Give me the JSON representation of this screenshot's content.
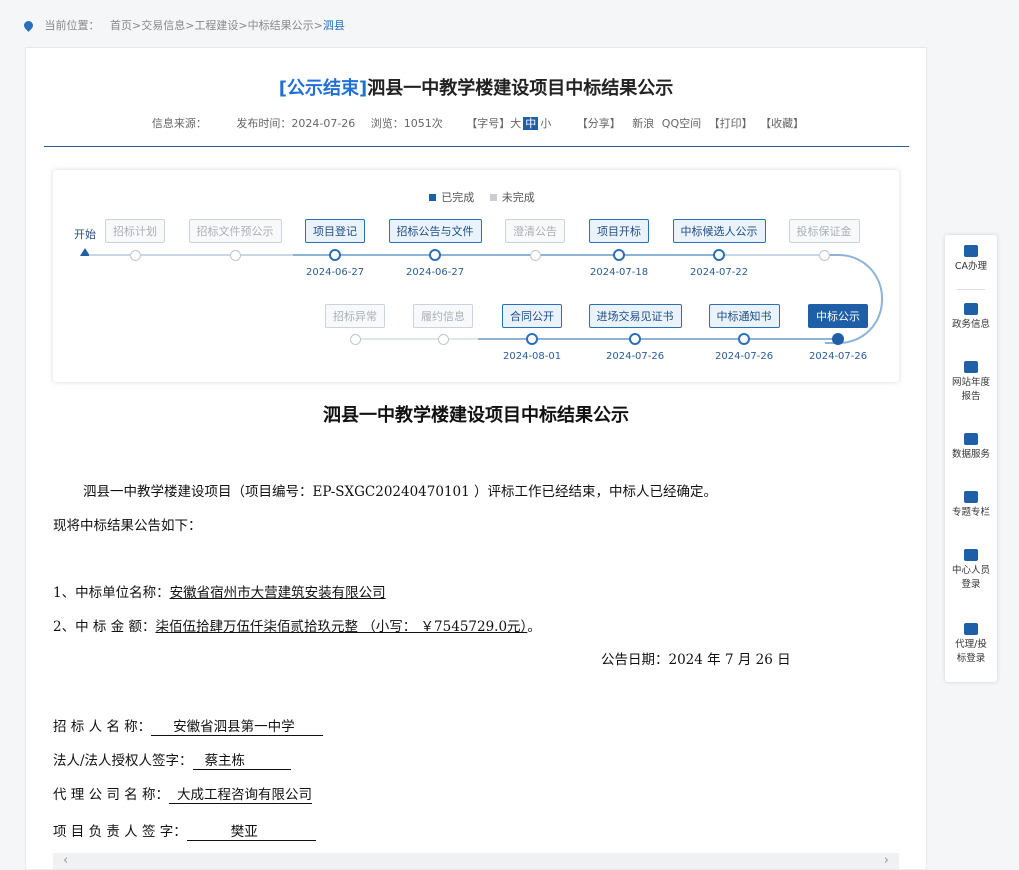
{
  "breadcrumb": {
    "label": "当前位置：",
    "items": [
      "首页>",
      "交易信息>",
      "工程建设>",
      "中标结果公示>"
    ],
    "current": "泗县"
  },
  "article": {
    "status_tag": "[公示结束]",
    "title": "泗县一中教学楼建设项目中标结果公示",
    "meta": {
      "source": "信息来源：",
      "publish_time": "发布时间：2024-07-26",
      "views": "浏览：1051次",
      "font_label": "【字号】",
      "font_large": "大",
      "font_medium": "中",
      "font_small": "小",
      "share_label": "【分享】",
      "share_sina": "新浪",
      "share_qq": "QQ空间",
      "print": "【打印】",
      "favorite": "【收藏】"
    }
  },
  "timeline": {
    "legend_done": "已完成",
    "legend_todo": "未完成",
    "start": "开始",
    "row1": [
      {
        "label": "招标计划",
        "state": "todo",
        "date": ""
      },
      {
        "label": "招标文件预公示",
        "state": "todo",
        "date": ""
      },
      {
        "label": "项目登记",
        "state": "done",
        "date": "2024-06-27"
      },
      {
        "label": "招标公告与文件",
        "state": "done",
        "date": "2024-06-27"
      },
      {
        "label": "澄清公告",
        "state": "todo",
        "date": ""
      },
      {
        "label": "项目开标",
        "state": "done",
        "date": "2024-07-18"
      },
      {
        "label": "中标候选人公示",
        "state": "done",
        "date": "2024-07-22"
      },
      {
        "label": "投标保证金",
        "state": "todo",
        "date": ""
      }
    ],
    "row2": [
      {
        "label": "招标异常",
        "state": "todo",
        "date": ""
      },
      {
        "label": "履约信息",
        "state": "todo",
        "date": ""
      },
      {
        "label": "合同公开",
        "state": "done",
        "date": "2024-08-01"
      },
      {
        "label": "进场交易见证书",
        "state": "done",
        "date": "2024-07-26"
      },
      {
        "label": "中标通知书",
        "state": "done",
        "date": "2024-07-26"
      },
      {
        "label": "中标公示",
        "state": "current",
        "date": "2024-07-26"
      }
    ]
  },
  "doc": {
    "title": "泗县一中教学楼建设项目中标结果公示",
    "intro": "泗县一中教学楼建设项目（项目编号：EP-SXGC20240470101 ）评标工作已经结束，中标人已经确定。",
    "intro2": "现将中标结果公告如下：",
    "item1_label": "1、中标单位名称：",
    "item1_value": "安徽省宿州市大营建筑安装有限公司",
    "item2_label": "2、中 标 金 额：",
    "item2_value": "柒佰伍拾肆万伍仟柒佰贰拾玖元整 （小写：  ￥7545729.0元）",
    "item2_end": "。",
    "notice_date": "公告日期：2024 年 7 月 26 日",
    "tenderer_label": "招 标 人 名 称：",
    "tenderer_value": "安徽省泗县第一中学",
    "legal_label": "法人/法人授权人签字：",
    "legal_value": "蔡主栋",
    "agent_label": "代 理 公 司 名 称：",
    "agent_value": "大成工程咨询有限公司",
    "pm_label": "项 目 负 责 人 签 字：",
    "pm_value": "樊亚"
  },
  "sidebar": {
    "items": [
      "CA办理",
      "政务信息",
      "网站年度报告",
      "数据服务",
      "专题专栏",
      "中心人员登录",
      "代理/投标登录"
    ]
  },
  "colors": {
    "accent": "#1f5fa8",
    "tag": "#1f6fd6",
    "todo": "#bfc6cd"
  }
}
